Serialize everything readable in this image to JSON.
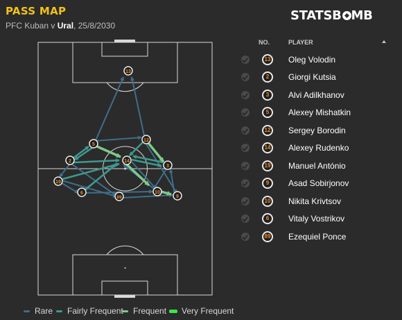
{
  "header": {
    "title": "PASS MAP",
    "home_team": "PFC Kuban",
    "separator": " v ",
    "away_team": "Ural",
    "date": ", 25/8/2030",
    "logo_text": "STATSB",
    "logo_text_end": "MB"
  },
  "table": {
    "col_no": "NO.",
    "col_player": "PLAYER",
    "players": [
      {
        "no": "13",
        "name": "Oleg Volodin"
      },
      {
        "no": "2",
        "name": "Giorgi Kutsia"
      },
      {
        "no": "3",
        "name": "Alvi Adilkhanov"
      },
      {
        "no": "5",
        "name": "Alexey Mishatkin"
      },
      {
        "no": "12",
        "name": "Sergey Borodin"
      },
      {
        "no": "14",
        "name": "Alexey Rudenko"
      },
      {
        "no": "19",
        "name": "Manuel António"
      },
      {
        "no": "9",
        "name": "Asad Sobirjonov"
      },
      {
        "no": "10",
        "name": "Nikita Krivtsov"
      },
      {
        "no": "6",
        "name": "Vitaly Vostrikov"
      },
      {
        "no": "89",
        "name": "Ezequiel Ponce"
      }
    ]
  },
  "legend": [
    {
      "label": "Rare",
      "color": "#3f6e8a"
    },
    {
      "label": "Fairly Frequent",
      "color": "#3d9a8f"
    },
    {
      "label": "Frequent",
      "color": "#7fc98a"
    },
    {
      "label": "Very Frequent",
      "color": "#39e84a"
    }
  ],
  "colors": {
    "title": "#f2c21a",
    "jersey_number": "#f28c28",
    "background": "#2b2b2b"
  },
  "pitch_players": [
    {
      "no": "13"
    },
    {
      "no": "5"
    },
    {
      "no": "12"
    },
    {
      "no": "2"
    },
    {
      "no": "14"
    },
    {
      "no": "3"
    },
    {
      "no": "19"
    },
    {
      "no": "6"
    },
    {
      "no": "89"
    },
    {
      "no": "10"
    },
    {
      "no": "9"
    }
  ]
}
